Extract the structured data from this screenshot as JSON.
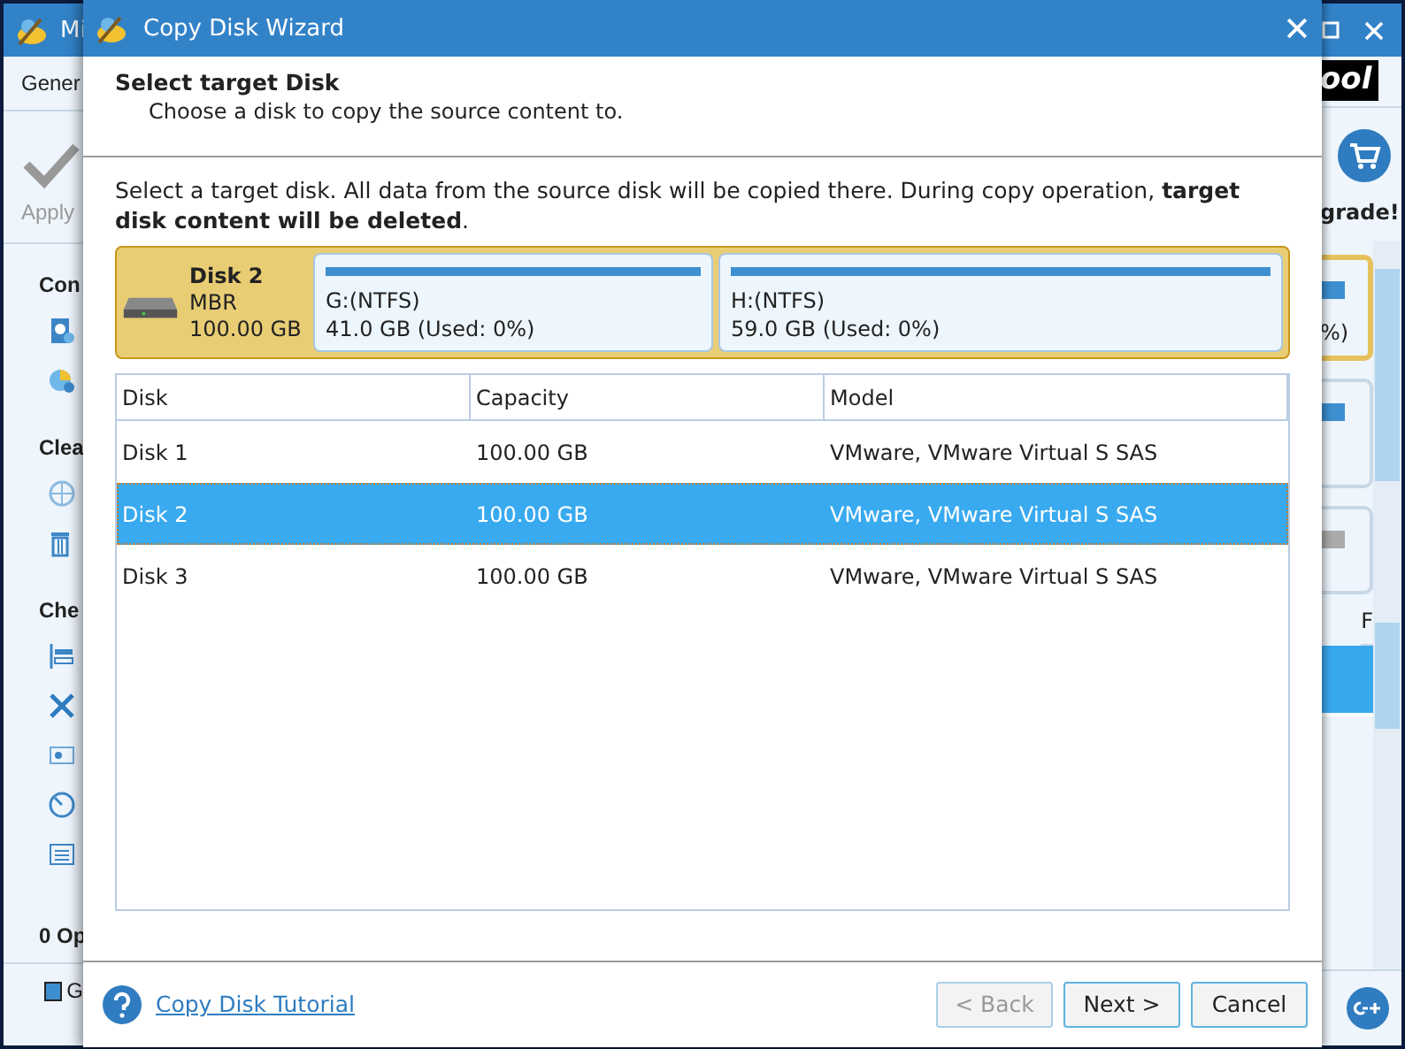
{
  "app": {
    "title": "Mi",
    "menu_item": "Gener",
    "toolbar_button": "Apply",
    "sections": [
      "Con",
      "Clea",
      "Che"
    ],
    "operations": "0 Op",
    "legend": "G",
    "logo": "ool",
    "upgrade": "grade!",
    "card_text": "%)",
    "column_header": "F"
  },
  "dialog": {
    "title": "Copy Disk Wizard",
    "heading": "Select target Disk",
    "subheading": "Choose a disk to copy the source content to.",
    "instruction": "Select a target disk. All data from the source disk will be copied there. During copy operation, **target disk content will be deleted**.",
    "disk": {
      "name": "Disk 2",
      "style": "MBR",
      "size": "100.00 GB",
      "partitions": [
        {
          "label": "G:(NTFS)",
          "usage": "41.0 GB (Used: 0%)"
        },
        {
          "label": "H:(NTFS)",
          "usage": "59.0 GB (Used: 0%)"
        }
      ]
    },
    "table": {
      "columns": [
        "Disk",
        "Capacity",
        "Model"
      ],
      "rows": [
        {
          "cells": [
            "Disk 1",
            "100.00 GB",
            "VMware, VMware Virtual S SAS"
          ],
          "selected": false
        },
        {
          "cells": [
            "Disk 2",
            "100.00 GB",
            "VMware, VMware Virtual S SAS"
          ],
          "selected": true
        },
        {
          "cells": [
            "Disk 3",
            "100.00 GB",
            "VMware, VMware Virtual S SAS"
          ],
          "selected": false
        }
      ]
    },
    "help_link": "Copy Disk Tutorial",
    "buttons": [
      {
        "label": "< Back",
        "disabled": true
      },
      {
        "label": "Next >",
        "disabled": false
      },
      {
        "label": "Cancel",
        "disabled": false
      }
    ]
  }
}
